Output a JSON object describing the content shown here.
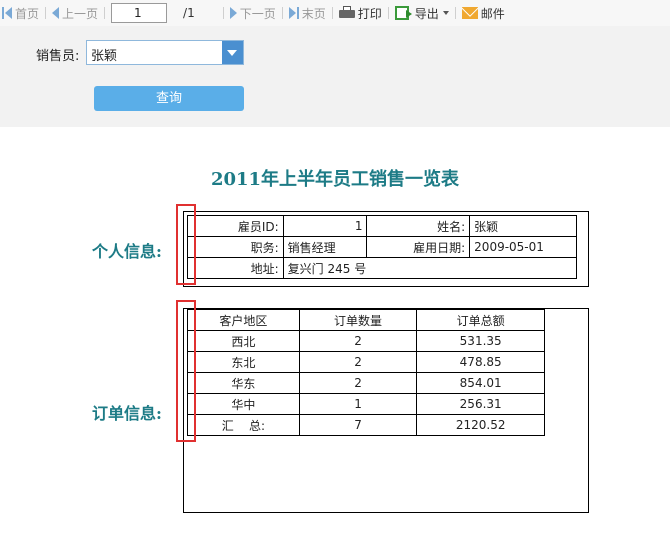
{
  "toolbar": {
    "first_label": "首页",
    "prev_label": "上一页",
    "page_value": "1",
    "page_total": "/1",
    "next_label": "下一页",
    "last_label": "末页",
    "print_label": "打印",
    "export_label": "导出",
    "mail_label": "邮件"
  },
  "filter": {
    "label": "销售员:",
    "select_value": "张颖",
    "query_label": "查询"
  },
  "report": {
    "title": "2011年上半年员工销售一览表",
    "personal_label": "个人信息:",
    "order_label": "订单信息:",
    "personal": {
      "id_label": "雇员ID:",
      "id_value": "1",
      "name_label": "姓名:",
      "name_value": "张颖",
      "title_label": "职务:",
      "title_value": "销售经理",
      "hire_label": "雇用日期:",
      "hire_value": "2009-05-01",
      "address_label": "地址:",
      "address_value": "复兴门 245 号"
    },
    "orders": {
      "headers": [
        "客户地区",
        "订单数量",
        "订单总额"
      ],
      "rows": [
        [
          "西北",
          "2",
          "531.35"
        ],
        [
          "东北",
          "2",
          "478.85"
        ],
        [
          "华东",
          "2",
          "854.01"
        ],
        [
          "华中",
          "1",
          "256.31"
        ]
      ],
      "total": [
        "汇    总:",
        "7",
        "2120.52"
      ]
    }
  },
  "colors": {
    "accent": "#1d7b86",
    "query_button": "#5aaee8",
    "highlight": "#e03030"
  }
}
